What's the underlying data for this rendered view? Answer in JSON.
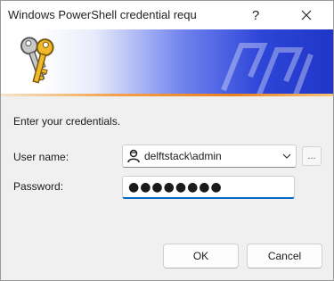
{
  "window": {
    "title": "Windows PowerShell credential requ",
    "help_label": "?"
  },
  "banner": {
    "accent_colors": [
      "#2e46d8",
      "#e9801c"
    ]
  },
  "form": {
    "prompt": "Enter your credentials.",
    "user_label": "User name:",
    "user_value": "delftstack\\admin",
    "password_label": "Password:",
    "password_mask": "●●●●●●●●",
    "browse_label": "..."
  },
  "buttons": {
    "ok": "OK",
    "cancel": "Cancel"
  },
  "icons": {
    "banner": "keys-icon",
    "user": "user-icon",
    "dropdown": "chevron-down-icon",
    "close": "close-icon"
  }
}
